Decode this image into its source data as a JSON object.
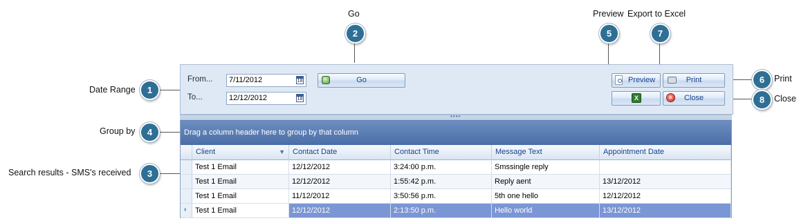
{
  "callouts": {
    "go": {
      "label": "Go",
      "number": "2"
    },
    "preview": {
      "label": "Preview",
      "number": "5"
    },
    "export": {
      "label": "Export to Excel",
      "number": "7"
    },
    "date_range": {
      "label": "Date Range",
      "number": "1"
    },
    "group_by": {
      "label": "Group by",
      "number": "4"
    },
    "search_results": {
      "label": "Search results - SMS's received",
      "number": "3"
    },
    "print": {
      "label": "Print",
      "number": "6"
    },
    "close": {
      "label": "Close",
      "number": "8"
    }
  },
  "filters": {
    "from_label": "From...",
    "from_value": "7/11/2012",
    "to_label": "To...",
    "to_value": "12/12/2012",
    "calendar_glyph": "18"
  },
  "toolbar": {
    "go_label": "Go",
    "preview_label": "Preview",
    "print_label": "Print",
    "close_label": "Close",
    "excel_glyph": "X"
  },
  "grid": {
    "group_by_text": "Drag a column header here to group by that column",
    "columns": [
      "Client",
      "Contact Date",
      "Contact Time",
      "Message Text",
      "Appointment Date"
    ],
    "rows": [
      [
        "Test 1 Email",
        "12/12/2012",
        "3:24:00 p.m.",
        "Smssingle reply",
        ""
      ],
      [
        "Test 1 Email",
        "12/12/2012",
        "1:55:42 p.m.",
        "Reply aent",
        "13/12/2012"
      ],
      [
        "Test 1 Email",
        "11/12/2012",
        "3:50:56 p.m.",
        "5th one hello",
        "12/12/2012"
      ],
      [
        "Test 1 Email",
        "12/12/2012",
        "2:13:50 p.m.",
        "Hello world",
        "13/12/2012"
      ]
    ],
    "selected_row": 3,
    "selected_color": "#7b96d4",
    "alt_row_color": "#f3f6fb"
  }
}
